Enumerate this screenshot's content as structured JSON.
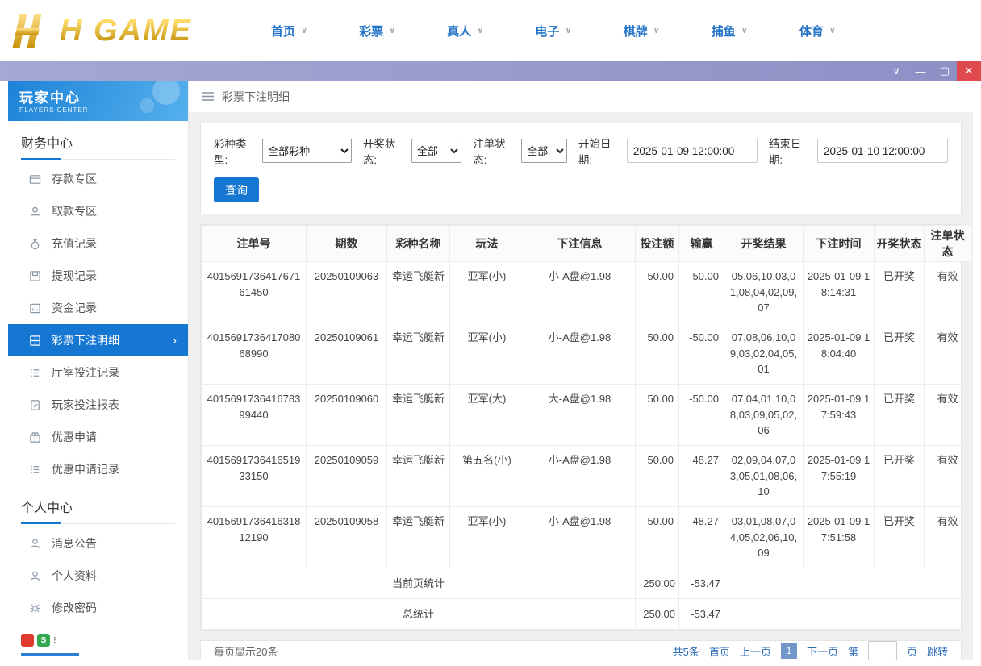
{
  "brand": {
    "logo_text": "H GAME"
  },
  "top_nav": {
    "items": [
      "首页",
      "彩票",
      "真人",
      "电子",
      "棋牌",
      "捕鱼",
      "体育"
    ]
  },
  "sidebar": {
    "header": {
      "title": "玩家中心",
      "subtitle": "PLAYERS CENTER"
    },
    "sections": [
      {
        "title": "财务中心",
        "items": [
          "存款专区",
          "取款专区",
          "充值记录",
          "提现记录",
          "资金记录",
          "彩票下注明细",
          "厅室投注记录",
          "玩家投注报表",
          "优惠申请",
          "优惠申请记录"
        ]
      },
      {
        "title": "个人中心",
        "items": [
          "消息公告",
          "个人资料",
          "修改密码"
        ]
      }
    ],
    "app_badge": "S"
  },
  "content": {
    "page_title": "彩票下注明细",
    "filters": {
      "lottery_type_label": "彩种类型:",
      "lottery_type_value": "全部彩种",
      "draw_status_label": "开奖状态:",
      "draw_status_value": "全部",
      "bet_status_label": "注单状态:",
      "bet_status_value": "全部",
      "start_date_label": "开始日期:",
      "start_date_value": "2025-01-09 12:00:00",
      "end_date_label": "结束日期:",
      "end_date_value": "2025-01-10 12:00:00",
      "search_button": "查询"
    },
    "table": {
      "columns": [
        "注单号",
        "期数",
        "彩种名称",
        "玩法",
        "下注信息",
        "投注额",
        "输赢",
        "开奖结果",
        "下注时间",
        "开奖状态",
        "注单状态"
      ],
      "rows": [
        {
          "bet_id": "401569173641767161450",
          "period": "20250109063",
          "lottery": "幸运飞艇新",
          "play": "亚军(小)",
          "bet_info": "小-A盘@1.98",
          "amount": "50.00",
          "win_loss": "-50.00",
          "result": "05,06,10,03,01,08,04,02,09,07",
          "bet_time": "2025-01-09 18:14:31",
          "draw_status": "已开奖",
          "bet_status": "有效"
        },
        {
          "bet_id": "401569173641708068990",
          "period": "20250109061",
          "lottery": "幸运飞艇新",
          "play": "亚军(小)",
          "bet_info": "小-A盘@1.98",
          "amount": "50.00",
          "win_loss": "-50.00",
          "result": "07,08,06,10,09,03,02,04,05,01",
          "bet_time": "2025-01-09 18:04:40",
          "draw_status": "已开奖",
          "bet_status": "有效"
        },
        {
          "bet_id": "401569173641678399440",
          "period": "20250109060",
          "lottery": "幸运飞艇新",
          "play": "亚军(大)",
          "bet_info": "大-A盘@1.98",
          "amount": "50.00",
          "win_loss": "-50.00",
          "result": "07,04,01,10,08,03,09,05,02,06",
          "bet_time": "2025-01-09 17:59:43",
          "draw_status": "已开奖",
          "bet_status": "有效"
        },
        {
          "bet_id": "401569173641651933150",
          "period": "20250109059",
          "lottery": "幸运飞艇新",
          "play": "第五名(小)",
          "bet_info": "小-A盘@1.98",
          "amount": "50.00",
          "win_loss": "48.27",
          "result": "02,09,04,07,03,05,01,08,06,10",
          "bet_time": "2025-01-09 17:55:19",
          "draw_status": "已开奖",
          "bet_status": "有效"
        },
        {
          "bet_id": "401569173641631812190",
          "period": "20250109058",
          "lottery": "幸运飞艇新",
          "play": "亚军(小)",
          "bet_info": "小-A盘@1.98",
          "amount": "50.00",
          "win_loss": "48.27",
          "result": "03,01,08,07,04,05,02,06,10,09",
          "bet_time": "2025-01-09 17:51:58",
          "draw_status": "已开奖",
          "bet_status": "有效"
        }
      ],
      "summary_rows": [
        {
          "label": "当前页统计",
          "amount": "250.00",
          "win_loss": "-53.47"
        },
        {
          "label": "总统计",
          "amount": "250.00",
          "win_loss": "-53.47"
        }
      ]
    },
    "pagination": {
      "page_size_text": "每页显示20条",
      "total_text": "共5条",
      "first": "首页",
      "prev": "上一页",
      "current_page": "1",
      "next": "下一页",
      "jump_prefix": "第",
      "jump_suffix": "页",
      "jump_button": "跳转"
    }
  }
}
